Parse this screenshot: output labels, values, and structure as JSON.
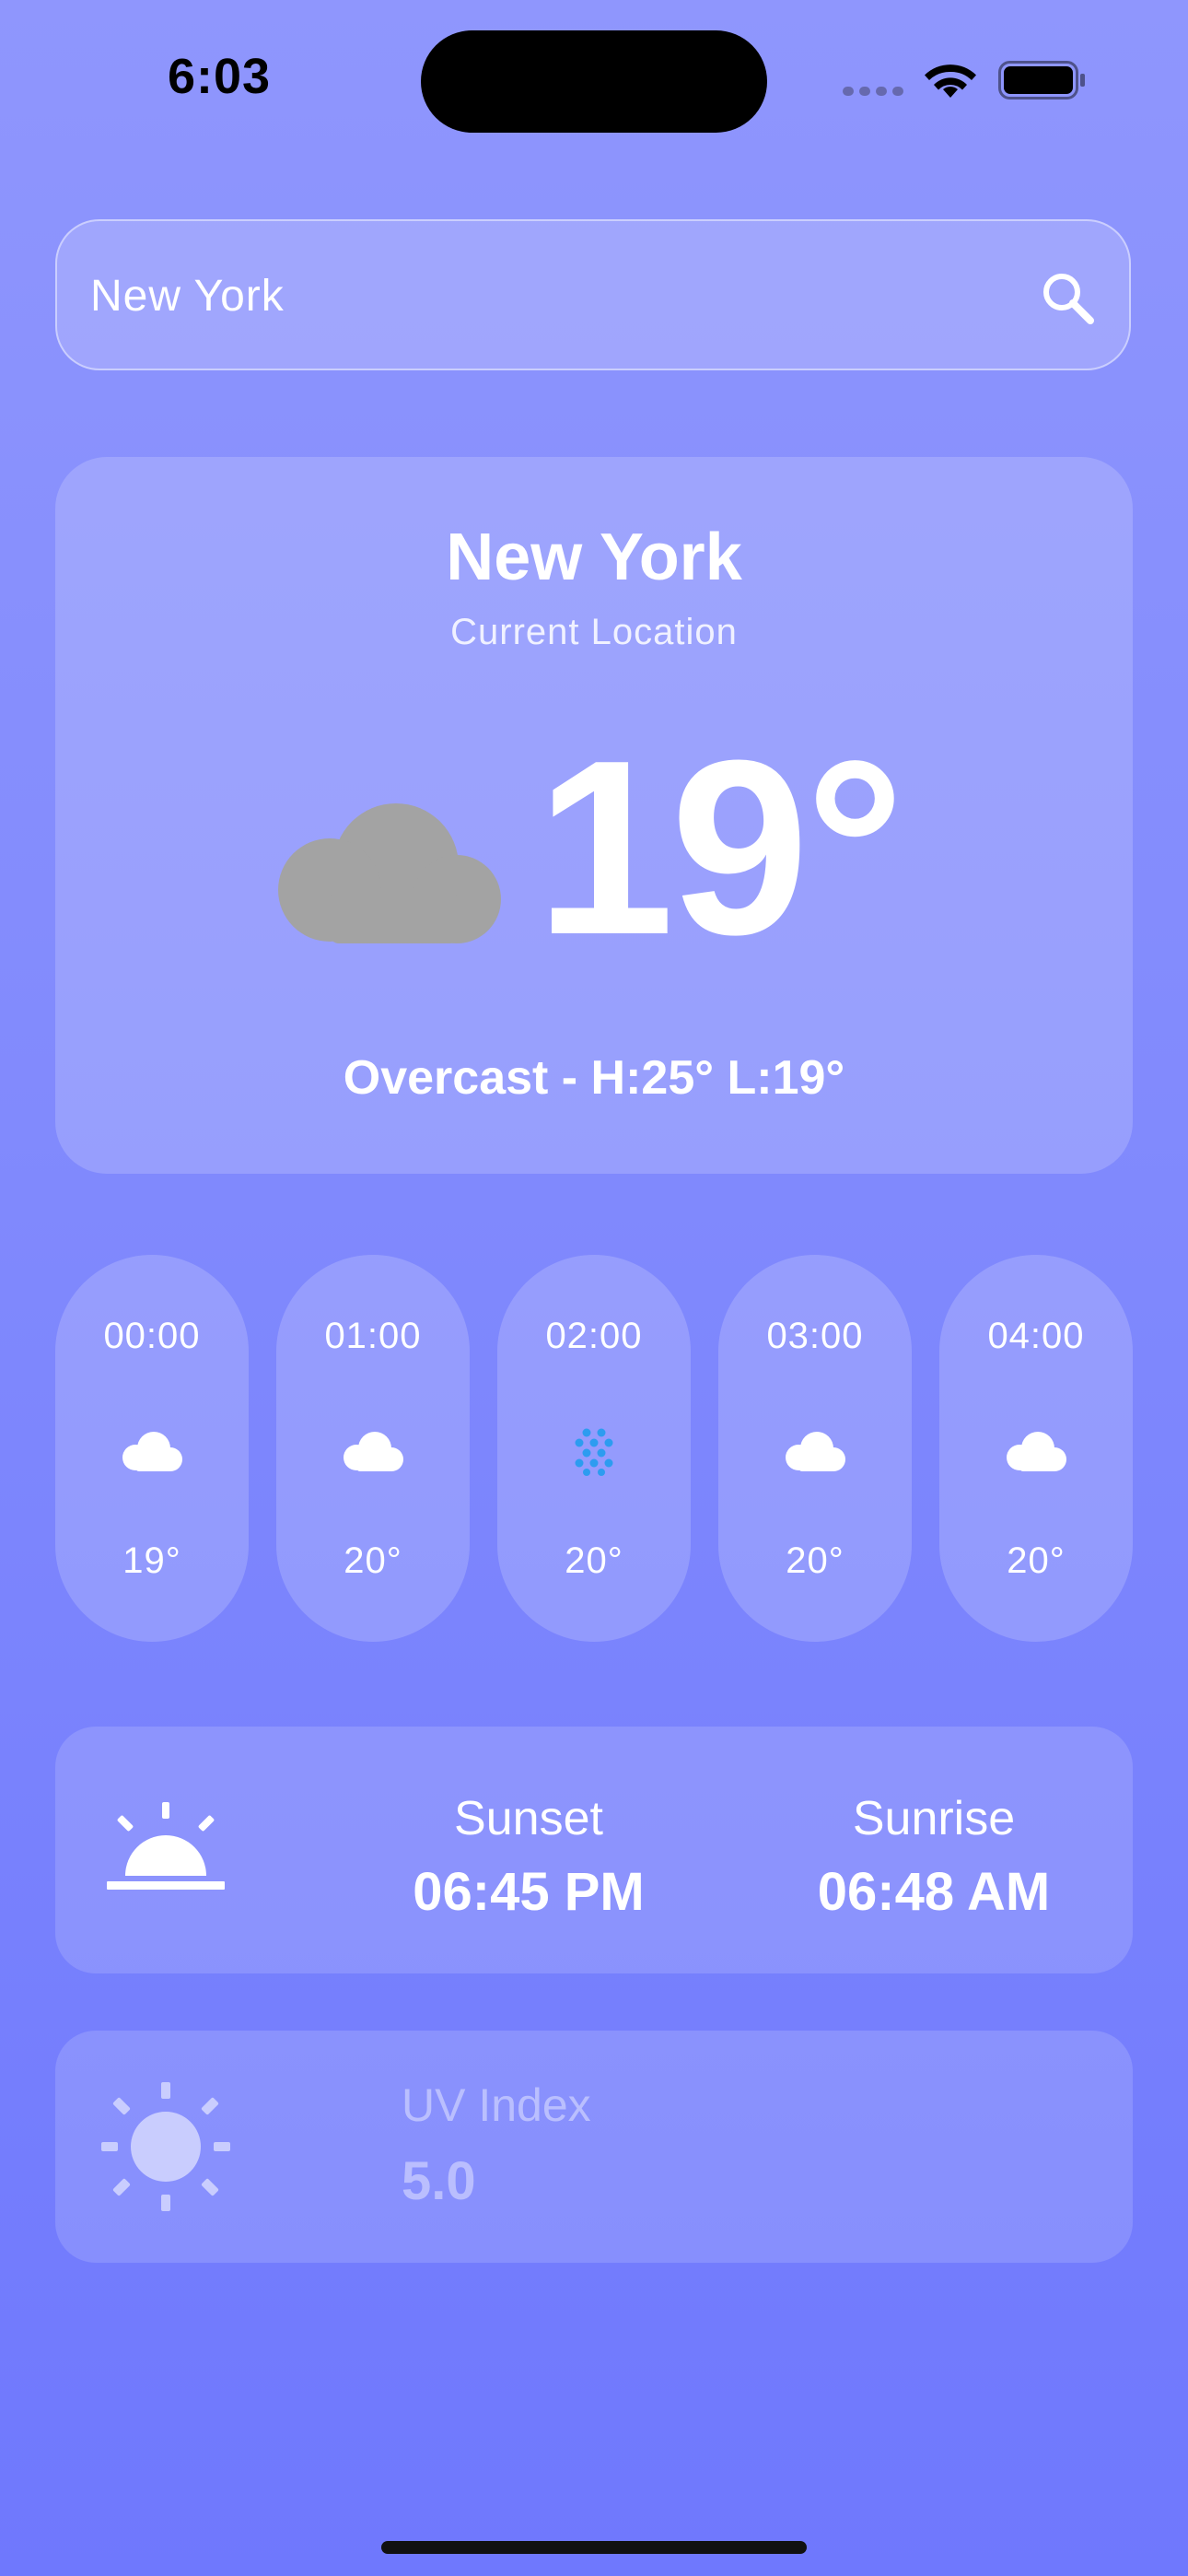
{
  "status_bar": {
    "time": "6:03"
  },
  "search": {
    "value": "New York",
    "icon": "search-icon"
  },
  "current": {
    "city": "New York",
    "location_label": "Current Location",
    "temperature": "19°",
    "condition_line": "Overcast - H:25° L:19°",
    "icon": "cloud-icon",
    "icon_color": "#a3a3a3"
  },
  "hourly": [
    {
      "time": "00:00",
      "temp": "19°",
      "icon": "cloud-icon"
    },
    {
      "time": "01:00",
      "temp": "20°",
      "icon": "cloud-icon"
    },
    {
      "time": "02:00",
      "temp": "20°",
      "icon": "drizzle-icon"
    },
    {
      "time": "03:00",
      "temp": "20°",
      "icon": "cloud-icon"
    },
    {
      "time": "04:00",
      "temp": "20°",
      "icon": "cloud-icon"
    }
  ],
  "sun": {
    "icon": "sunrise-icon",
    "sunset_label": "Sunset",
    "sunset_time": "06:45 PM",
    "sunrise_label": "Sunrise",
    "sunrise_time": "06:48 AM"
  },
  "uv": {
    "icon": "sun-icon",
    "label": "UV Index",
    "value": "5.0"
  },
  "colors": {
    "background_top": "#8f96fd",
    "background_bottom": "#6f78fd",
    "drizzle_accent": "#2d9cf0"
  }
}
